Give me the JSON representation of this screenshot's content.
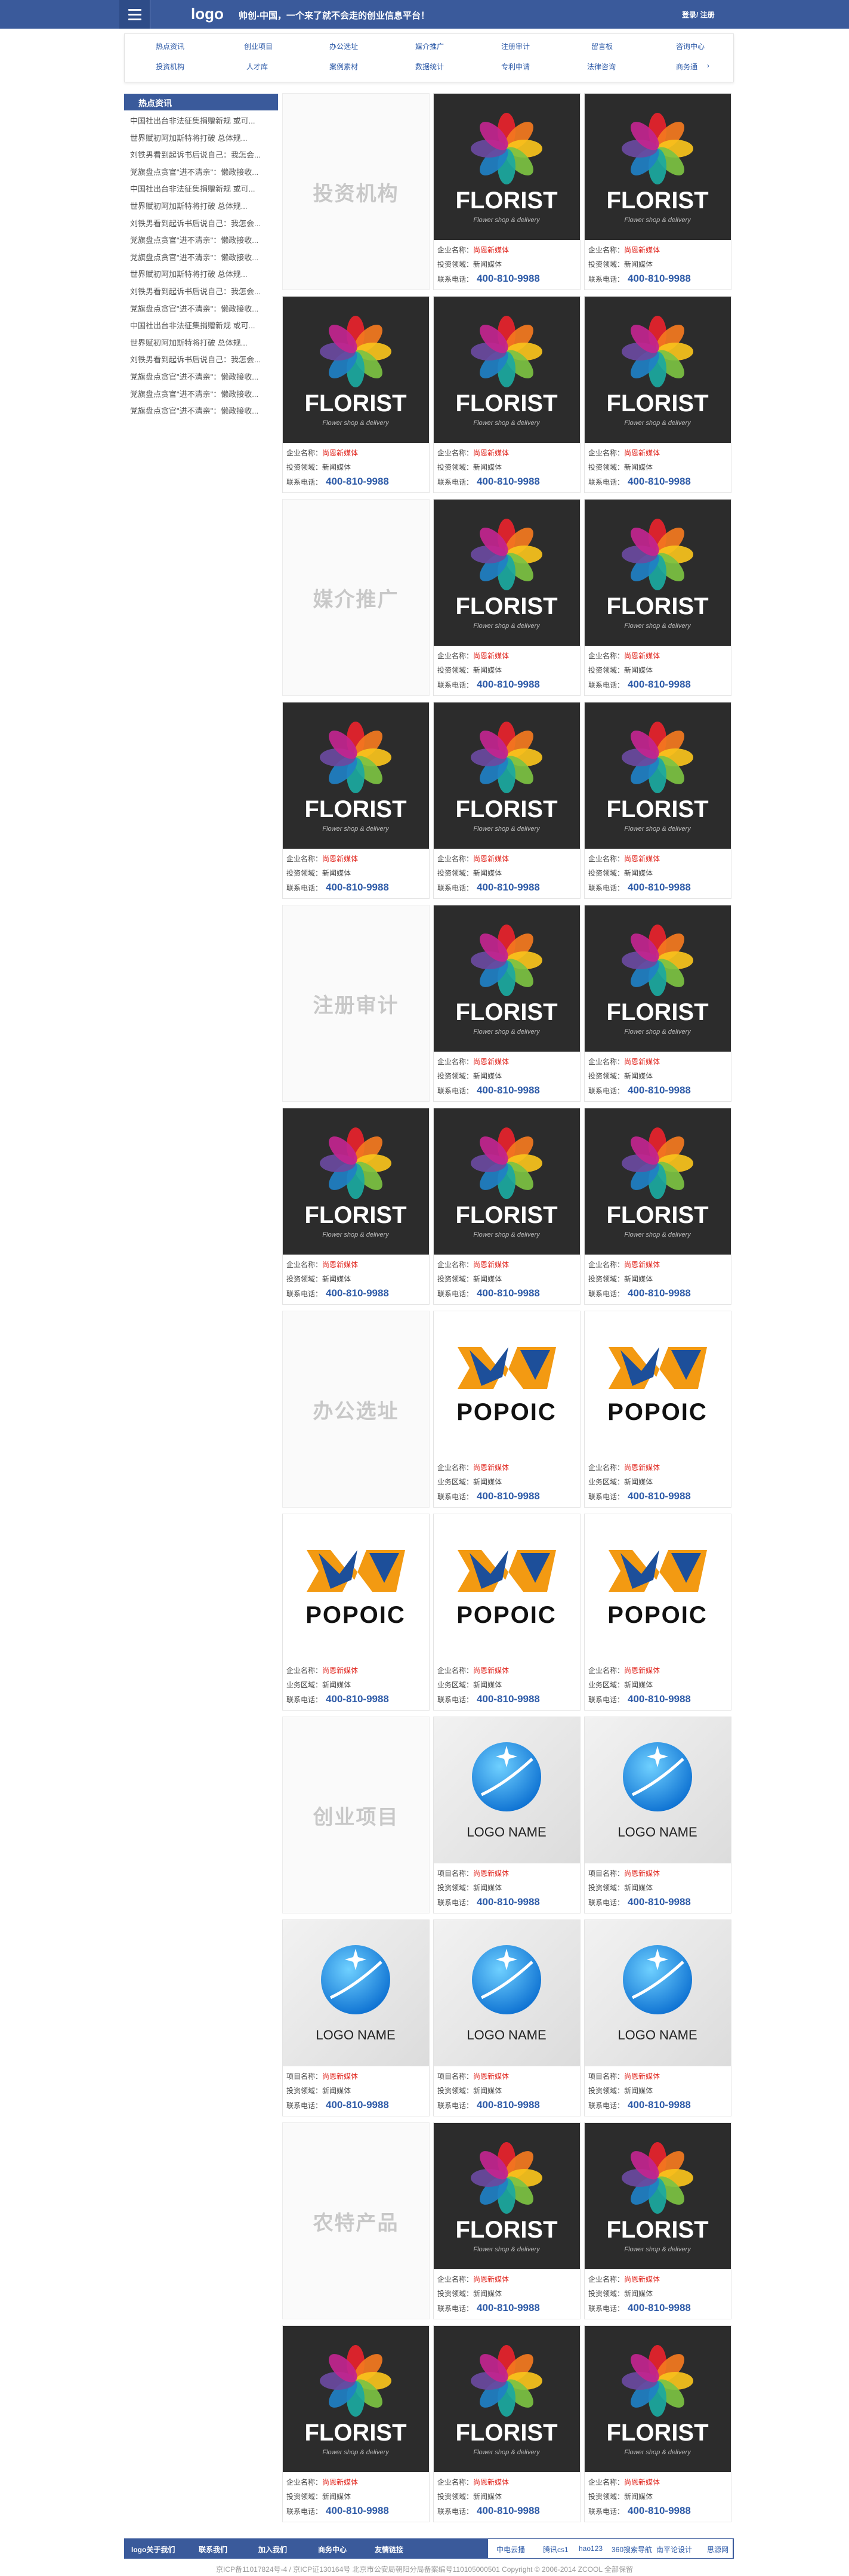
{
  "header": {
    "logo": "logo",
    "slogan": "帅创-中国，一个来了就不会走的创业信息平台！",
    "login": "登录/ 注册"
  },
  "nav": {
    "row1": [
      "热点资讯",
      "创业项目",
      "办公选址",
      "媒介推广",
      "注册审计",
      "留言板",
      "咨询中心"
    ],
    "row2": [
      "投资机构",
      "人才库",
      "案例素材",
      "数据统计",
      "专利申请",
      "法律咨询",
      "商务通"
    ],
    "more_arrow": "›"
  },
  "sidebar": {
    "title": "热点资讯",
    "items": [
      "中国社出台非法征集捐赠新规 或可...",
      "世界赋初阿加斯特将打破 总体规...",
      "刘铁男看到起诉书后说自己：我怎会...",
      "党旗盘点贪官\"进不清亲\"：懒政接收...",
      "中国社出台非法征集捐赠新规 或可...",
      "世界赋初阿加斯特将打破 总体规...",
      "刘铁男看到起诉书后说自己：我怎会...",
      "党旗盘点贪官\"进不清亲\"：懒政接收...",
      "党旗盘点贪官\"进不清亲\"：懒政接收...",
      "世界赋初阿加斯特将打破 总体规...",
      "刘铁男看到起诉书后说自己：我怎会...",
      "党旗盘点贪官\"进不清亲\"：懒政接收...",
      "中国社出台非法征集捐赠新规 或可...",
      "世界赋初阿加斯特将打破 总体规...",
      "刘铁男看到起诉书后说自己：我怎会...",
      "党旗盘点贪官\"进不清亲\"：懒政接收...",
      "党旗盘点贪官\"进不清亲\"：懒政接收...",
      "党旗盘点贪官\"进不清亲\"：懒政接收..."
    ]
  },
  "categories": [
    "投资机构",
    "媒介推广",
    "注册审计",
    "办公选址",
    "创业项目",
    "农特产品"
  ],
  "card_florist": {
    "brand": "FLORIST",
    "tagline": "Flower shop & delivery",
    "label1": "企业名称：",
    "value1": "尚恩新媒体",
    "label2": "投资领域：",
    "value2": "新闻媒体",
    "label3": "联系电话：",
    "phone": "400-810-9988"
  },
  "card_popoic": {
    "brand": "POPOIC",
    "label1": "企业名称：",
    "value1": "尚恩新媒体",
    "label2": "业务区域：",
    "value2": "新闻媒体",
    "label3": "联系电话：",
    "phone": "400-810-9988"
  },
  "card_globe": {
    "brand": "LOGO NAME",
    "label1": "项目名称：",
    "value1": "尚恩新媒体",
    "label2": "投资领域：",
    "value2": "新闻媒体",
    "label3": "联系电话：",
    "phone": "400-810-9988"
  },
  "footer": {
    "links": [
      "logo关于我们",
      "联系我们",
      "加入我们",
      "商务中心"
    ],
    "friends": [
      "友情链接",
      "中电云播",
      "腾讯cs1",
      "hao123",
      "360搜索导航",
      "南平论设计",
      "思源网"
    ],
    "copyright": "京ICP备11017824号-4 / 京ICP证130164号 北京市公安局朝阳分局备案编号110105000501 Copyright © 2006-2014 ZCOOL 全部保留"
  },
  "colors": {
    "brand_blue": "#3a5a9b",
    "accent_red": "#e0231b",
    "link_blue": "#2e5ba8"
  }
}
